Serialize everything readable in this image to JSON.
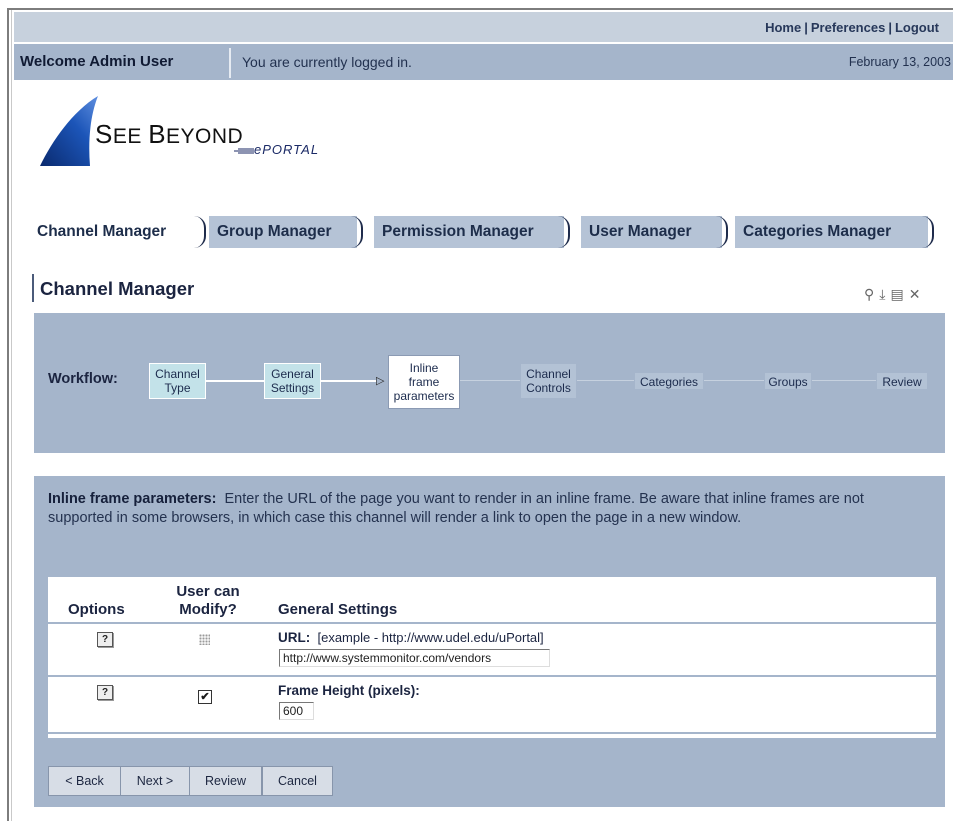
{
  "header": {
    "links": [
      "Home",
      "Preferences",
      "Logout"
    ],
    "separator": "|",
    "welcome": "Welcome Admin User",
    "status": "You are currently logged in.",
    "date": "February 13, 2003"
  },
  "logo": {
    "brand_big_s": "S",
    "brand_rest1": "EE ",
    "brand_big_b": "B",
    "brand_rest2": "EYOND",
    "product": "ePORTAL"
  },
  "tabs": [
    "Channel Manager",
    "Group Manager",
    "Permission Manager",
    "User Manager",
    "Categories Manager"
  ],
  "page": {
    "title": "Channel Manager",
    "tool_icons": [
      "magnifier-icon",
      "download-icon",
      "properties-icon",
      "close-icon"
    ]
  },
  "workflow": {
    "label": "Workflow:",
    "steps": [
      {
        "line1": "Channel",
        "line2": "Type",
        "line3": "",
        "state": "done"
      },
      {
        "line1": "General",
        "line2": "Settings",
        "line3": "",
        "state": "done"
      },
      {
        "line1": "Inline",
        "line2": "frame",
        "line3": "parameters",
        "state": "current"
      },
      {
        "line1": "Channel",
        "line2": "Controls",
        "line3": "",
        "state": "todo"
      },
      {
        "line1": "Categories",
        "line2": "",
        "line3": "",
        "state": "todo"
      },
      {
        "line1": "Groups",
        "line2": "",
        "line3": "",
        "state": "todo"
      },
      {
        "line1": "Review",
        "line2": "",
        "line3": "",
        "state": "todo"
      }
    ]
  },
  "section": {
    "heading": "Inline frame parameters:",
    "description": "Enter the URL of the page you want to render in an inline frame. Be aware that inline frames are not supported in some browsers, in which case this channel will render a link to open the page in a new window."
  },
  "table": {
    "col_options": "Options",
    "col_modify_line1": "User can",
    "col_modify_line2": "Modify?",
    "col_settings": "General Settings",
    "rows": [
      {
        "help": "?",
        "label": "URL:",
        "hint": "[example - http://www.udel.edu/uPortal]",
        "value": "http://www.systemmonitor.com/vendors",
        "modifiable": "disabled"
      },
      {
        "help": "?",
        "label": "Frame Height (pixels):",
        "hint": "",
        "value": "600",
        "modifiable": "checked",
        "check_mark": "✔"
      }
    ]
  },
  "buttons": {
    "back": "< Back",
    "next": "Next >",
    "review": "Review",
    "cancel": "Cancel"
  }
}
